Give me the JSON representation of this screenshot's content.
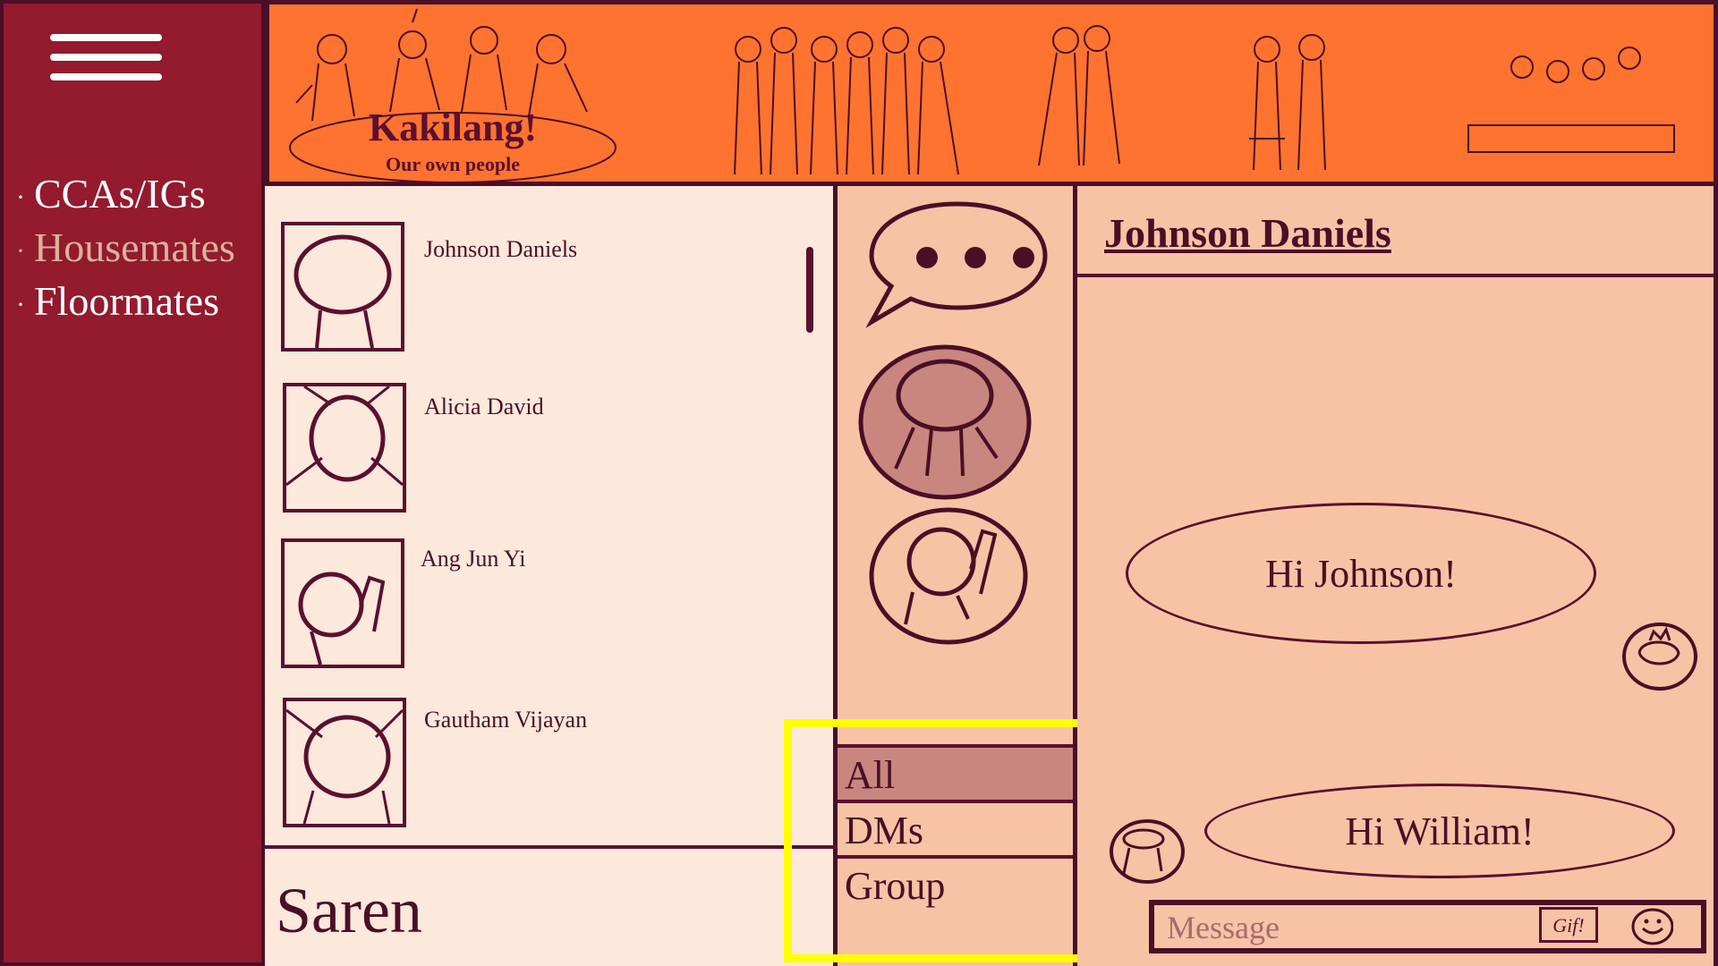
{
  "sidebar": {
    "menu_icon": "hamburger-menu-icon",
    "bullet": "·",
    "items": [
      {
        "label": "CCAs/IGs",
        "active": false
      },
      {
        "label": "Housemates",
        "active": true
      },
      {
        "label": "Floormates",
        "active": false
      }
    ]
  },
  "banner": {
    "logo_title": "Kakilang!",
    "logo_subtitle": "Our own people"
  },
  "contacts": {
    "items": [
      {
        "name": "Johnson Daniels"
      },
      {
        "name": "Alicia David"
      },
      {
        "name": "Ang Jun Yi"
      },
      {
        "name": "Gautham Vijayan"
      }
    ],
    "current_user": "Saren"
  },
  "filters": {
    "items": [
      {
        "label": "All",
        "active": true
      },
      {
        "label": "DMs",
        "active": false
      },
      {
        "label": "Group",
        "active": false
      }
    ]
  },
  "chat": {
    "title": "Johnson Daniels",
    "messages": [
      {
        "text": "Hi Johnson!",
        "from": "me"
      },
      {
        "text": "Hi William!",
        "from": "them"
      }
    ],
    "input_placeholder": "Message",
    "gif_label": "Gif!"
  },
  "colors": {
    "sidebar": "#941a2e",
    "banner": "#ff7330",
    "contacts_bg": "#fde8dc",
    "panel_bg": "#f8c3a5",
    "active_fill": "#c8867e",
    "outline": "#4a0f27",
    "highlight": "#ffff00"
  }
}
